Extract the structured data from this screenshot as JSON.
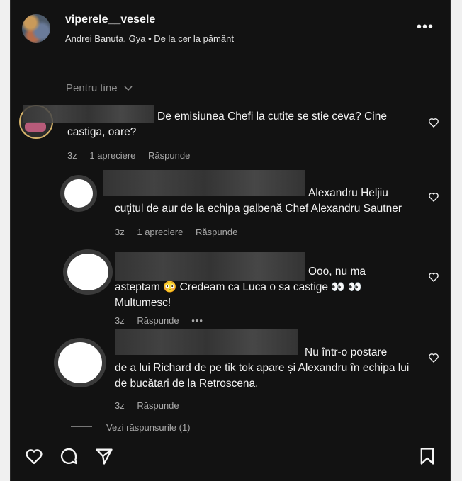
{
  "header": {
    "username": "viperele__vesele",
    "subtitle": "Andrei Banuta, Gya • De la cer la pământ",
    "more": "•••"
  },
  "sort": {
    "label": "Pentru tine"
  },
  "comments": [
    {
      "text": "De emisiunea Chefi la cutite se stie ceva? Cine castiga, oare?",
      "time": "3z",
      "likes": "1 apreciere",
      "reply": "Răspunde"
    }
  ],
  "replies": [
    {
      "line1": "Alexandru Heljiu",
      "rest": "cuţitul de aur de la echipa galbenă Chef Alexandru Sautner",
      "time": "3z",
      "likes": "1 apreciere",
      "reply": "Răspunde"
    },
    {
      "line1": "Ooo, nu ma",
      "rest": "asteptam 😳 Credeam ca Luca o sa castige 👀 👀 Multumesc!",
      "time": "3z",
      "reply": "Răspunde",
      "more": "•••"
    },
    {
      "line1": "Nu într-o postare",
      "rest": "de a lui Richard de pe tik tok apare și Alexandru în echipa lui de bucătari de la Retroscena.",
      "time": "3z",
      "reply": "Răspunde"
    }
  ],
  "view_replies": "Vezi răspunsurile (1)",
  "icons": [
    "heart-icon",
    "comment-icon",
    "share-icon",
    "bookmark-icon",
    "chevron-down-icon",
    "more-icon"
  ],
  "colors": {
    "background": "#121212",
    "text": "#f5f5f5",
    "muted": "#a8a8a8"
  }
}
